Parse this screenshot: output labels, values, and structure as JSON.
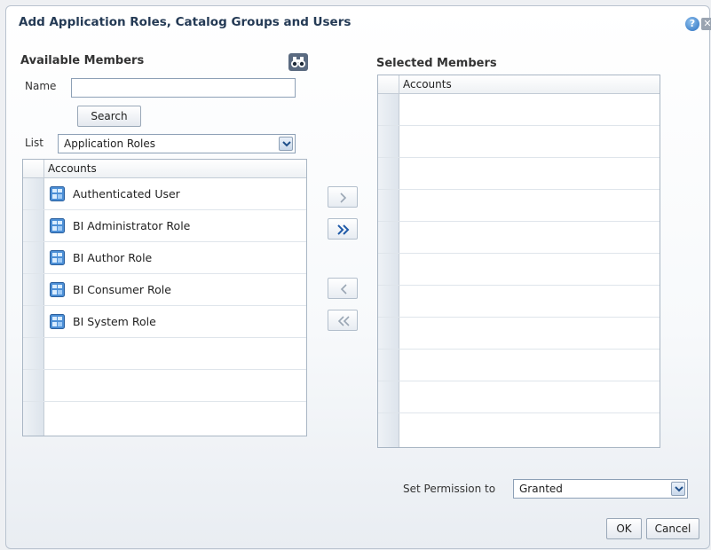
{
  "dialog": {
    "title": "Add Application Roles, Catalog Groups and Users",
    "help_icon": "question-icon",
    "close_icon": "close-icon"
  },
  "available": {
    "title": "Available Members",
    "name_label": "Name",
    "name_value": "",
    "search_label": "Search",
    "list_label": "List",
    "list_selected": "Application Roles",
    "column_header": "Accounts",
    "items": [
      {
        "label": "Authenticated User",
        "icon": "application-role-icon"
      },
      {
        "label": "BI Administrator Role",
        "icon": "application-role-icon"
      },
      {
        "label": "BI Author Role",
        "icon": "application-role-icon"
      },
      {
        "label": "BI Consumer Role",
        "icon": "application-role-icon"
      },
      {
        "label": "BI System Role",
        "icon": "application-role-icon"
      }
    ]
  },
  "selected": {
    "title": "Selected Members",
    "column_header": "Accounts",
    "items": []
  },
  "shuttle": {
    "move": "move-right-icon",
    "move_all": "move-all-right-icon",
    "remove": "move-left-icon",
    "remove_all": "move-all-left-icon"
  },
  "permission": {
    "label": "Set Permission to",
    "selected": "Granted"
  },
  "footer": {
    "ok_label": "OK",
    "cancel_label": "Cancel"
  }
}
